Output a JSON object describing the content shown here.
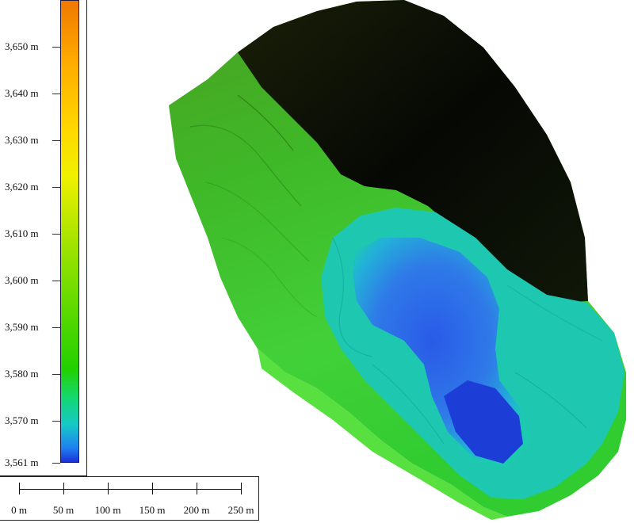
{
  "legend": {
    "labels": [
      "3,650 m",
      "3,640 m",
      "3,630 m",
      "3,620 m",
      "3,610 m",
      "3,600 m",
      "3,590 m",
      "3,580 m",
      "3,570 m",
      "3,561 m"
    ],
    "min_value": 3561,
    "max_value": 3660,
    "colormap": [
      "#1a30d8",
      "#16c8c8",
      "#22d000",
      "#a6e400",
      "#f0f000",
      "#ffae00",
      "#f07800"
    ]
  },
  "scale_bar": {
    "labels": [
      "0 m",
      "50 m",
      "100 m",
      "150 m",
      "200 m",
      "250 m"
    ]
  },
  "map": {
    "type": "elevation-model",
    "colors": {
      "shadow": "#050603",
      "high_terrain": "#3fa820",
      "mid_terrain": "#40cc30",
      "pit_rim": "#1cc8b4",
      "pit_floor": "#2f6ae8",
      "pit_bottom": "#1a3ad8"
    }
  }
}
